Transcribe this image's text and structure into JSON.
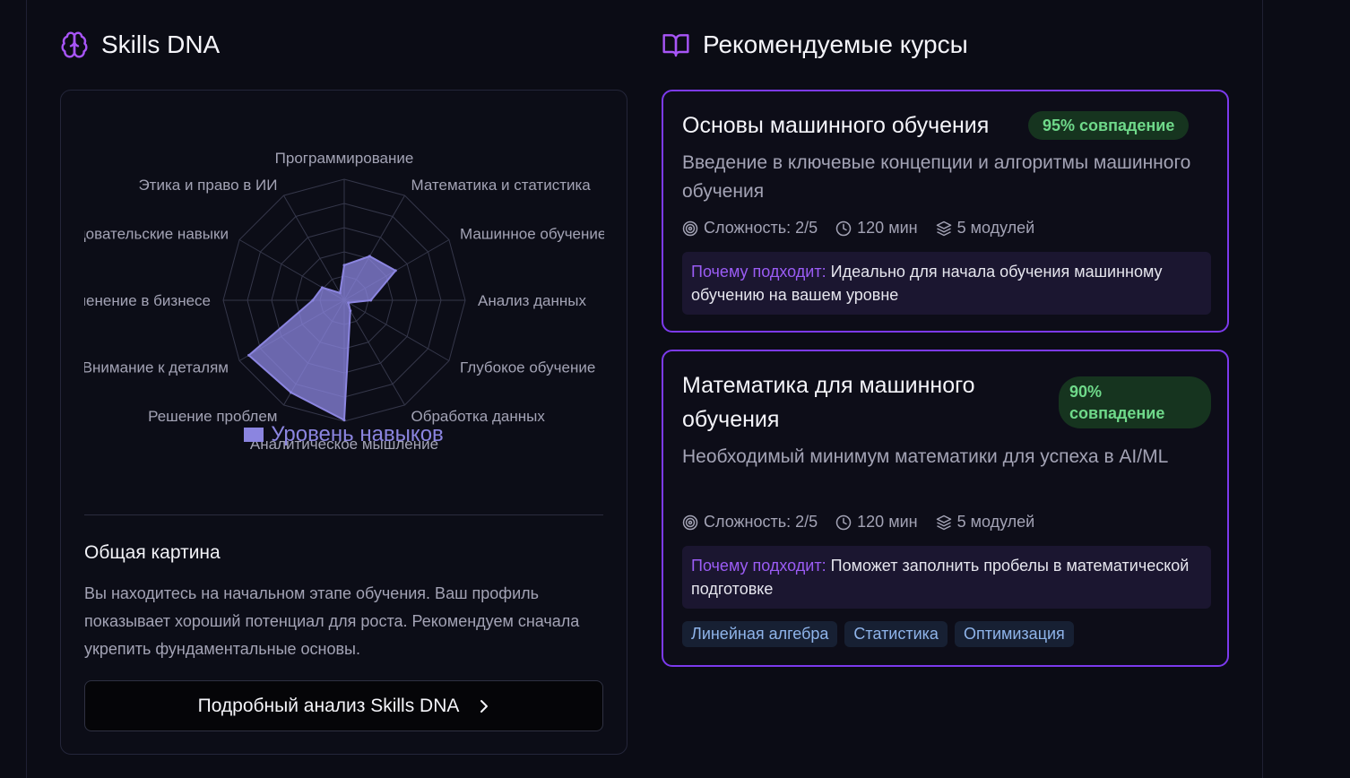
{
  "skills": {
    "title": "Skills DNA",
    "legend": "Уровень навыков",
    "overview_title": "Общая картина",
    "overview_text": "Вы находитесь на начальном этапе обучения. Ваш профиль показывает хороший потенциал для роста. Рекомендуем сначала укрепить фундаментальные основы.",
    "detail_button": "Подробный анализ Skills DNA",
    "axes": [
      "Программирование",
      "Математика и статистика",
      "Машинное обучение",
      "Анализ данных",
      "Глубокое обучение",
      "Обработка данных",
      "Аналитическое мышление",
      "Решение проблем",
      "Внимание к деталям",
      "Применение в бизнесе",
      "Исследовательские навыки",
      "Этика и право в ИИ"
    ],
    "values": [
      0.29,
      0.42,
      0.49,
      0.22,
      0.04,
      0.1,
      0.99,
      0.88,
      0.91,
      0.26,
      0.21,
      0.07
    ],
    "color": "#8b85e0"
  },
  "courses": {
    "title": "Рекомендуемые курсы",
    "items": [
      {
        "title": "Основы машинного обучения",
        "match": "95% совпадение",
        "description": "Введение в ключевые концепции и алгоритмы машинного обучения",
        "difficulty": "Сложность: 2/5",
        "duration": "120 мин",
        "modules": "5 модулей",
        "why_label": "Почему подходит:",
        "why_text": "Идеально для начала обучения машинному обучению на вашем уровне",
        "tags": []
      },
      {
        "title": "Математика для машинного обучения",
        "match": "90% совпадение",
        "description": "Необходимый минимум математики для успеха в AI/ML",
        "difficulty": "Сложность: 2/5",
        "duration": "120 мин",
        "modules": "5 модулей",
        "why_label": "Почему подходит:",
        "why_text": "Поможет заполнить пробелы в математической подготовке",
        "tags": [
          "Линейная алгебра",
          "Статистика",
          "Оптимизация"
        ]
      }
    ]
  },
  "colors": {
    "background": "#0b0c15",
    "accent_purple": "#7c3aed",
    "match_green": "#6fd98a",
    "radar_fill": "#8b85e0"
  }
}
